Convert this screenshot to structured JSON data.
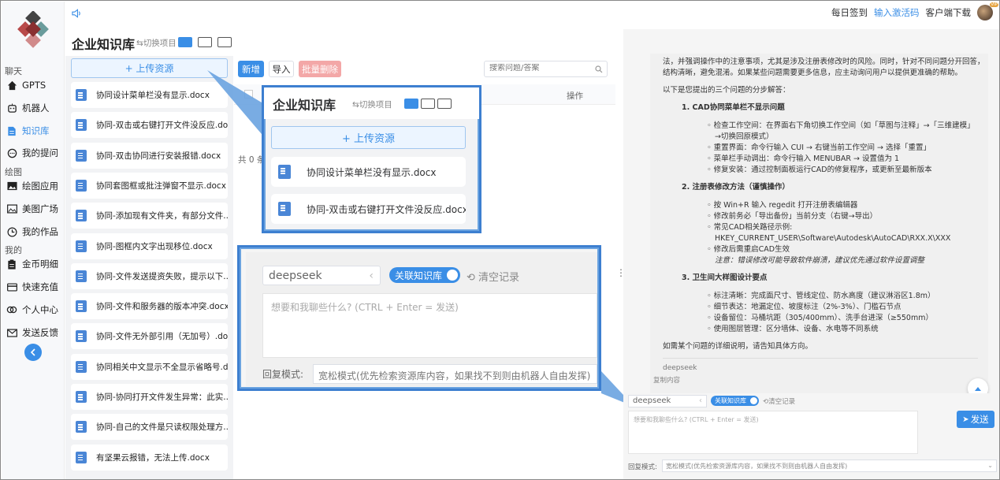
{
  "nav": {
    "sections": {
      "chat": "聊天",
      "draw": "绘图",
      "mine": "我的"
    },
    "items": [
      {
        "label": "GPTS",
        "icon": "home-icon"
      },
      {
        "label": "机器人",
        "icon": "robot-icon"
      },
      {
        "label": "知识库",
        "icon": "document-icon"
      },
      {
        "label": "我的提问",
        "icon": "chat-bubble-icon"
      },
      {
        "label": "绘图应用",
        "icon": "image-icon"
      },
      {
        "label": "美图广场",
        "icon": "gallery-icon"
      },
      {
        "label": "我的作品",
        "icon": "clock-icon"
      },
      {
        "label": "金币明细",
        "icon": "clipboard-icon"
      },
      {
        "label": "快速充值",
        "icon": "card-icon"
      },
      {
        "label": "个人中心",
        "icon": "user-link-icon"
      },
      {
        "label": "发送反馈",
        "icon": "mail-icon"
      }
    ],
    "collapse_icon": "chevron-left-icon"
  },
  "header": {
    "checkin": "每日签到",
    "activation": "输入激活码",
    "download": "客户端下载",
    "vip_badge": "VIP"
  },
  "kb": {
    "title": "企业知识库",
    "switch": "切换项目",
    "upload": "+ 上传资源"
  },
  "files": [
    "协同设计菜单栏没有显示.docx",
    "协同-双击或右键打开文件没反应.docx",
    "协同-双击协同进行安装报错.docx",
    "协同套图框或批注弹窗不显示.docx",
    "协同-添加现有文件夹，有部分文件...",
    "协同-图框内文字出现移位.docx",
    "协同-文件发送提资失败，提示以下...",
    "协同-文件和服务器的版本冲突.docx",
    "协同-文件无外部引用（无加号）.docx",
    "协同相关中文显示不全显示省略号.d...",
    "协同-协同打开文件发生异常：此实...",
    "协同-自己的文件是只读权限处理方...",
    "有坚果云报错，无法上传.docx"
  ],
  "toolbar": {
    "add": "新增",
    "import": "导入",
    "batch_delete": "批量删除",
    "search_placeholder": "搜索问题/答案"
  },
  "table": {
    "col_action": "操作",
    "total": "共 0 条"
  },
  "chat_input": {
    "model": "deepseek",
    "kb_toggle": "关联知识库",
    "clear": "清空记录",
    "placeholder": "想要和我聊些什么? (CTRL + Enter = 发送)",
    "reply_mode_label": "回复模式:",
    "reply_mode_value": "宽松模式(优先检索资源库内容，如果找不到则由机器人自由发挥)",
    "send": "发送"
  },
  "answer": {
    "intro1": "法，并强调操作中的注意事项，尤其是涉及注册表修改时的风险。同时，针对不同问题分开回答，",
    "intro2": "结构清晰，避免混淆。如果某些问题需要更多信息，应主动询问用户以提供更准确的帮助。",
    "lead": "以下是您提出的三个问题的分步解答：",
    "sections": [
      {
        "title": "1. CAD协同菜单栏不显示问题",
        "lines": [
          "检查工作空间：在界面右下角切换工作空间（如「草图与注释」→「三维建模」",
          "→切换回原模式）",
          "重置界面：命令行输入 CUI → 右键当前工作空间 → 选择「重置」",
          "菜单栏手动调出：命令行输入 MENUBAR → 设置值为 1",
          "修复安装：通过控制面板运行CAD的修复程序，或更新至最新版本"
        ]
      },
      {
        "title": "2. 注册表修改方法（谨慎操作）",
        "lines": [
          "按 Win+R 输入 regedit 打开注册表编辑器",
          "修改前务必「导出备份」当前分支（右键→导出）",
          "常见CAD相关路径示例:",
          "HKEY_CURRENT_USER\\Software\\Autodesk\\AutoCAD\\RXX.X\\XXX",
          "修改后需重启CAD生效",
          "注意：错误修改可能导致软件崩溃，建议优先通过软件设置调整"
        ]
      },
      {
        "title": "3. 卫生间大样图设计要点",
        "lines": [
          "标注清晰：完成面尺寸、管线定位、防水高度（建议淋浴区1.8m）",
          "细节表达：地漏定位、坡度标注（2%-3%）、门槛石节点",
          "设备留位：马桶坑距（305/400mm）、洗手台进深（≥550mm）",
          "使用图层管理：区分墙体、设备、水电等不同系统"
        ]
      }
    ],
    "outro": "如需某个问题的详细说明，请告知具体方向。",
    "model": "deepseek",
    "copy": "复制内容"
  },
  "colors": {
    "accent": "#3a8ee6",
    "danger_light": "#f3a7a7",
    "callout": "#3d7fd0"
  }
}
